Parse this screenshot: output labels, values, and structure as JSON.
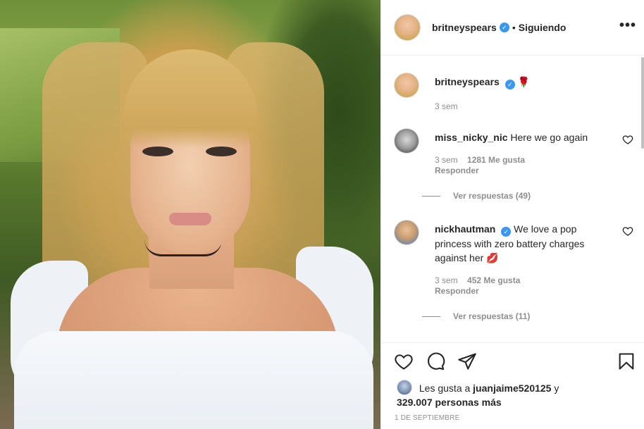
{
  "post": {
    "username": "britneyspears",
    "verified_mark": "✓",
    "separator": "•",
    "follow_status": "Siguiendo",
    "more_icon": "•••"
  },
  "caption": {
    "username": "britneyspears",
    "emoji": "🌹",
    "time": "3 sem"
  },
  "comments": [
    {
      "username": "miss_nicky_nic",
      "text": "Here we go again",
      "time": "3 sem",
      "likes": "1281 Me gusta",
      "reply": "Responder",
      "view_replies": "Ver respuestas (49)"
    },
    {
      "username": "nickhautman",
      "text": "We love a pop princess with zero battery charges against her",
      "emoji": "💋",
      "time": "3 sem",
      "likes": "452 Me gusta",
      "reply": "Responder",
      "view_replies": "Ver respuestas (11)"
    }
  ],
  "likes_line": {
    "prefix": "Les gusta a",
    "user": "juanjaime520125",
    "connector": "y",
    "count": "329.007 personas más"
  },
  "date": "1 DE SEPTIEMBRE",
  "icons": [
    "heart-icon",
    "comment-icon",
    "share-icon",
    "bookmark-icon"
  ],
  "colors": {
    "verified": "#3897f0",
    "muted": "#8e8e8e",
    "text": "#262626",
    "border": "#efefef"
  }
}
